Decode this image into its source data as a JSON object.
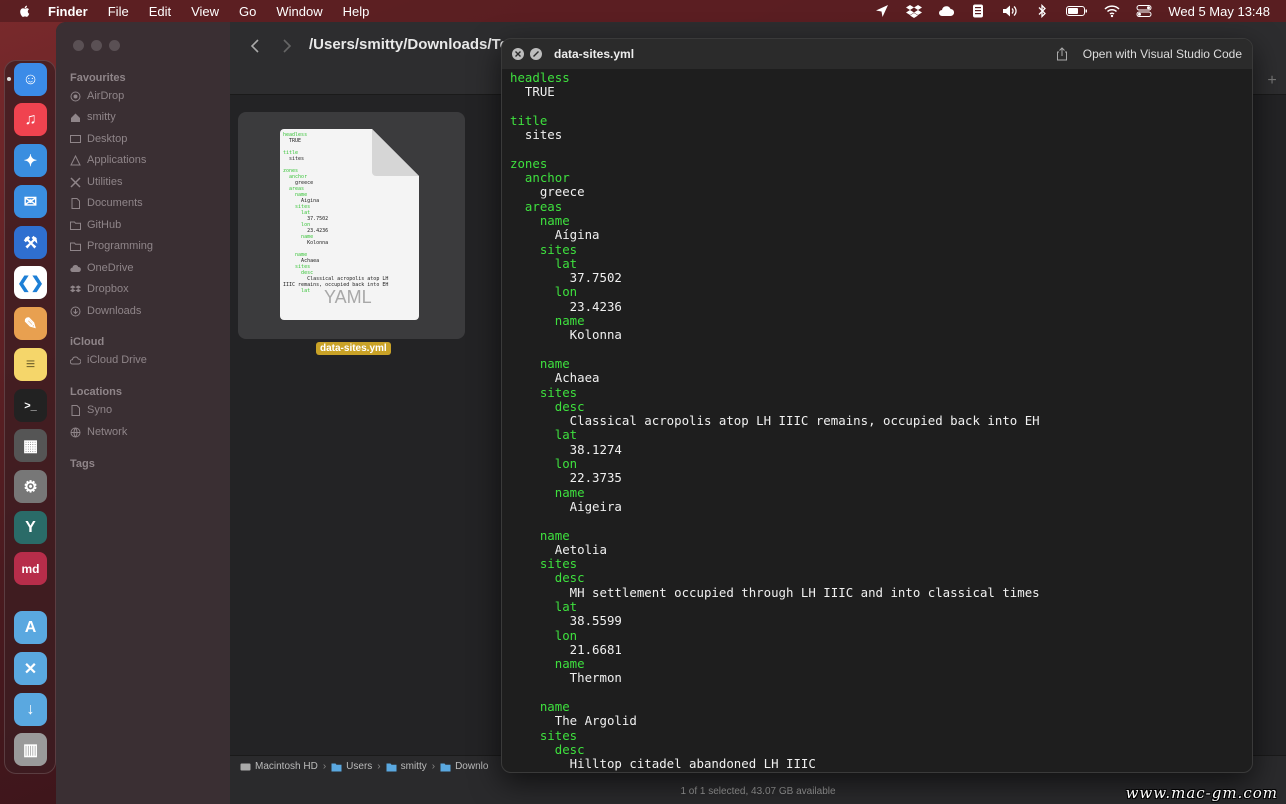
{
  "menubar": {
    "app": "Finder",
    "items": [
      "File",
      "Edit",
      "View",
      "Go",
      "Window",
      "Help"
    ],
    "clock": "Wed 5 May  13:48"
  },
  "dock": {
    "apps": [
      {
        "name": "finder",
        "color": "#3b8be8",
        "glyph": "☺"
      },
      {
        "name": "music",
        "color": "#f0434f",
        "glyph": "♫"
      },
      {
        "name": "safari",
        "color": "#3a8ee0",
        "glyph": "✦"
      },
      {
        "name": "mail",
        "color": "#3a8ee0",
        "glyph": "✉"
      },
      {
        "name": "xcode",
        "color": "#2f6fd0",
        "glyph": "⚒"
      },
      {
        "name": "vscode",
        "color": "#ffffff",
        "glyph": "❮❯"
      },
      {
        "name": "pixelmator",
        "color": "#e8a050",
        "glyph": "✎"
      },
      {
        "name": "notes",
        "color": "#f5d66a",
        "glyph": "≡"
      },
      {
        "name": "terminal",
        "color": "#222222",
        "glyph": ">_"
      },
      {
        "name": "calculator",
        "color": "#555555",
        "glyph": "▦"
      },
      {
        "name": "system-preferences",
        "color": "#777777",
        "glyph": "⚙"
      },
      {
        "name": "yaml-previewer",
        "color": "#2a6b68",
        "glyph": "Y"
      },
      {
        "name": "markdown-previewer",
        "color": "#b72d4a",
        "glyph": "md"
      },
      {
        "name": "applications-folder",
        "color": "#5aa8e0",
        "glyph": "A"
      },
      {
        "name": "utilities-folder",
        "color": "#5aa8e0",
        "glyph": "✕"
      },
      {
        "name": "downloads-folder",
        "color": "#5aa8e0",
        "glyph": "↓"
      },
      {
        "name": "trash",
        "color": "#9a9a9a",
        "glyph": "🗑"
      }
    ]
  },
  "sidebar": {
    "favourites_label": "Favourites",
    "favourites": [
      "AirDrop",
      "smitty",
      "Desktop",
      "Applications",
      "Utilities",
      "Documents",
      "GitHub",
      "Programming",
      "OneDrive",
      "Dropbox",
      "Downloads"
    ],
    "icloud_label": "iCloud",
    "icloud": [
      "iCloud Drive"
    ],
    "locations_label": "Locations",
    "locations": [
      "Syno",
      "Network"
    ],
    "tags_label": "Tags"
  },
  "toolbar": {
    "path_title": "/Users/smitty/Downloads/Test"
  },
  "file": {
    "name": "data-sites.yml",
    "badge": "YAML",
    "thumb_lines": [
      [
        "k",
        "headless"
      ],
      [
        "v",
        "  TRUE"
      ],
      [
        "v",
        ""
      ],
      [
        "k",
        "title"
      ],
      [
        "v",
        "  sites"
      ],
      [
        "v",
        ""
      ],
      [
        "k",
        "zones"
      ],
      [
        "k",
        "  anchor"
      ],
      [
        "v",
        "    greece"
      ],
      [
        "k",
        "  areas"
      ],
      [
        "k",
        "    name"
      ],
      [
        "v",
        "      Aigina"
      ],
      [
        "k",
        "    sites"
      ],
      [
        "k",
        "      lat"
      ],
      [
        "v",
        "        37.7502"
      ],
      [
        "k",
        "      lon"
      ],
      [
        "v",
        "        23.4236"
      ],
      [
        "k",
        "      name"
      ],
      [
        "v",
        "        Kolonna"
      ],
      [
        "v",
        ""
      ],
      [
        "k",
        "    name"
      ],
      [
        "v",
        "      Achaea"
      ],
      [
        "k",
        "    sites"
      ],
      [
        "k",
        "      desc"
      ],
      [
        "v",
        "        Classical acropolis atop LH"
      ],
      [
        "v",
        "IIIC remains, occupied back into EH"
      ],
      [
        "k",
        "      lat"
      ]
    ]
  },
  "pathbar": [
    "Macintosh HD",
    "Users",
    "smitty",
    "Downlo"
  ],
  "status": "1 of 1 selected, 43.07 GB available",
  "quicklook": {
    "title": "data-sites.yml",
    "open_button": "Open with Visual Studio Code",
    "lines": [
      {
        "t": "k",
        "s": "headless"
      },
      {
        "t": "v",
        "s": "  TRUE"
      },
      {
        "t": "v",
        "s": ""
      },
      {
        "t": "k",
        "s": "title"
      },
      {
        "t": "v",
        "s": "  sites"
      },
      {
        "t": "v",
        "s": ""
      },
      {
        "t": "k",
        "s": "zones"
      },
      {
        "t": "k",
        "s": "  anchor"
      },
      {
        "t": "v",
        "s": "    greece"
      },
      {
        "t": "k",
        "s": "  areas"
      },
      {
        "t": "k",
        "s": "    name"
      },
      {
        "t": "v",
        "s": "      Aígina"
      },
      {
        "t": "k",
        "s": "    sites"
      },
      {
        "t": "k",
        "s": "      lat"
      },
      {
        "t": "v",
        "s": "        37.7502"
      },
      {
        "t": "k",
        "s": "      lon"
      },
      {
        "t": "v",
        "s": "        23.4236"
      },
      {
        "t": "k",
        "s": "      name"
      },
      {
        "t": "v",
        "s": "        Kolonna"
      },
      {
        "t": "v",
        "s": ""
      },
      {
        "t": "k",
        "s": "    name"
      },
      {
        "t": "v",
        "s": "      Achaea"
      },
      {
        "t": "k",
        "s": "    sites"
      },
      {
        "t": "k",
        "s": "      desc"
      },
      {
        "t": "v",
        "s": "        Classical acropolis atop LH IIIC remains, occupied back into EH"
      },
      {
        "t": "k",
        "s": "      lat"
      },
      {
        "t": "v",
        "s": "        38.1274"
      },
      {
        "t": "k",
        "s": "      lon"
      },
      {
        "t": "v",
        "s": "        22.3735"
      },
      {
        "t": "k",
        "s": "      name"
      },
      {
        "t": "v",
        "s": "        Aigeira"
      },
      {
        "t": "v",
        "s": ""
      },
      {
        "t": "k",
        "s": "    name"
      },
      {
        "t": "v",
        "s": "      Aetolia"
      },
      {
        "t": "k",
        "s": "    sites"
      },
      {
        "t": "k",
        "s": "      desc"
      },
      {
        "t": "v",
        "s": "        MH settlement occupied through LH IIIC and into classical times"
      },
      {
        "t": "k",
        "s": "      lat"
      },
      {
        "t": "v",
        "s": "        38.5599"
      },
      {
        "t": "k",
        "s": "      lon"
      },
      {
        "t": "v",
        "s": "        21.6681"
      },
      {
        "t": "k",
        "s": "      name"
      },
      {
        "t": "v",
        "s": "        Thermon"
      },
      {
        "t": "v",
        "s": ""
      },
      {
        "t": "k",
        "s": "    name"
      },
      {
        "t": "v",
        "s": "      The Argolid"
      },
      {
        "t": "k",
        "s": "    sites"
      },
      {
        "t": "k",
        "s": "      desc"
      },
      {
        "t": "v",
        "s": "        Hilltop citadel abandoned LH IIIC"
      }
    ]
  },
  "watermark": "www.mac-gm.com"
}
